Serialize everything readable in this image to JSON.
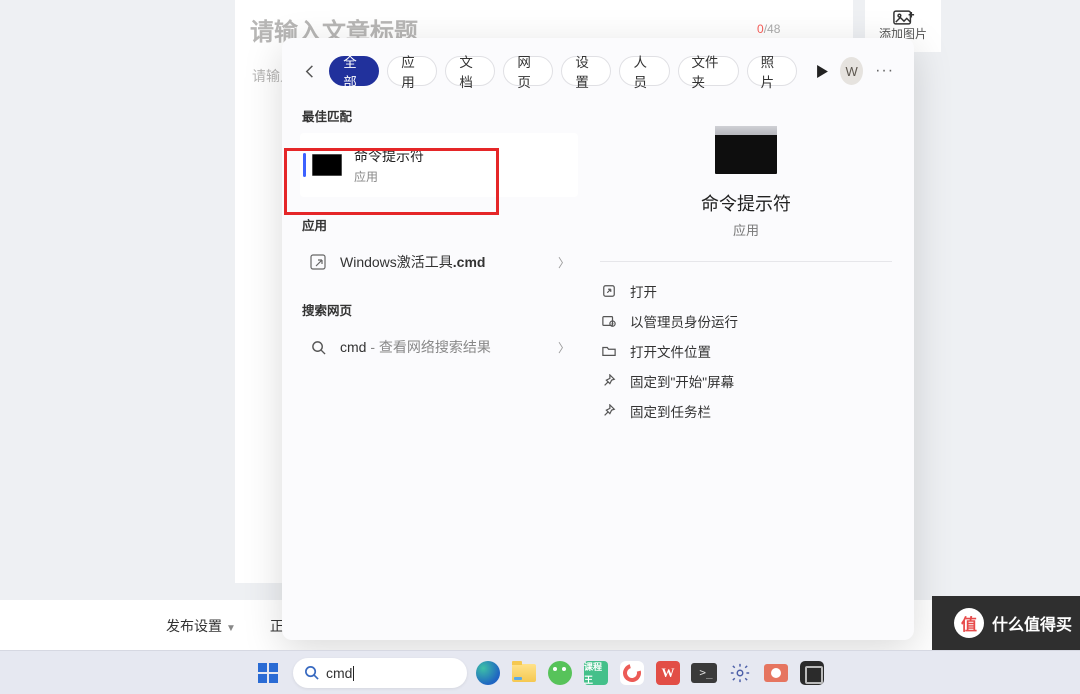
{
  "background": {
    "title_placeholder": "请输入文章标题",
    "body_placeholder": "请输入",
    "char_count": "0",
    "char_limit": "/48",
    "add_image_label": "添加图片",
    "footer_publish": "发布设置",
    "footer_body": "正文"
  },
  "search_panel": {
    "tabs": [
      "全部",
      "应用",
      "文档",
      "网页",
      "设置",
      "人员",
      "文件夹",
      "照片"
    ],
    "active_tab_index": 0,
    "user_initial": "W",
    "sections": {
      "best_match_label": "最佳匹配",
      "apps_label": "应用",
      "web_label": "搜索网页"
    },
    "best_match": {
      "title": "命令提示符",
      "subtitle": "应用"
    },
    "apps": [
      {
        "pre": "Windows激活工具",
        "bold": ".cmd"
      }
    ],
    "web": [
      {
        "term": "cmd",
        "suffix": " - 查看网络搜索结果"
      }
    ],
    "preview": {
      "title": "命令提示符",
      "subtitle": "应用",
      "actions": [
        "打开",
        "以管理员身份运行",
        "打开文件位置",
        "固定到\"开始\"屏幕",
        "固定到任务栏"
      ]
    }
  },
  "taskbar": {
    "search_value": "cmd"
  },
  "brand": {
    "text": "什么值得买"
  }
}
